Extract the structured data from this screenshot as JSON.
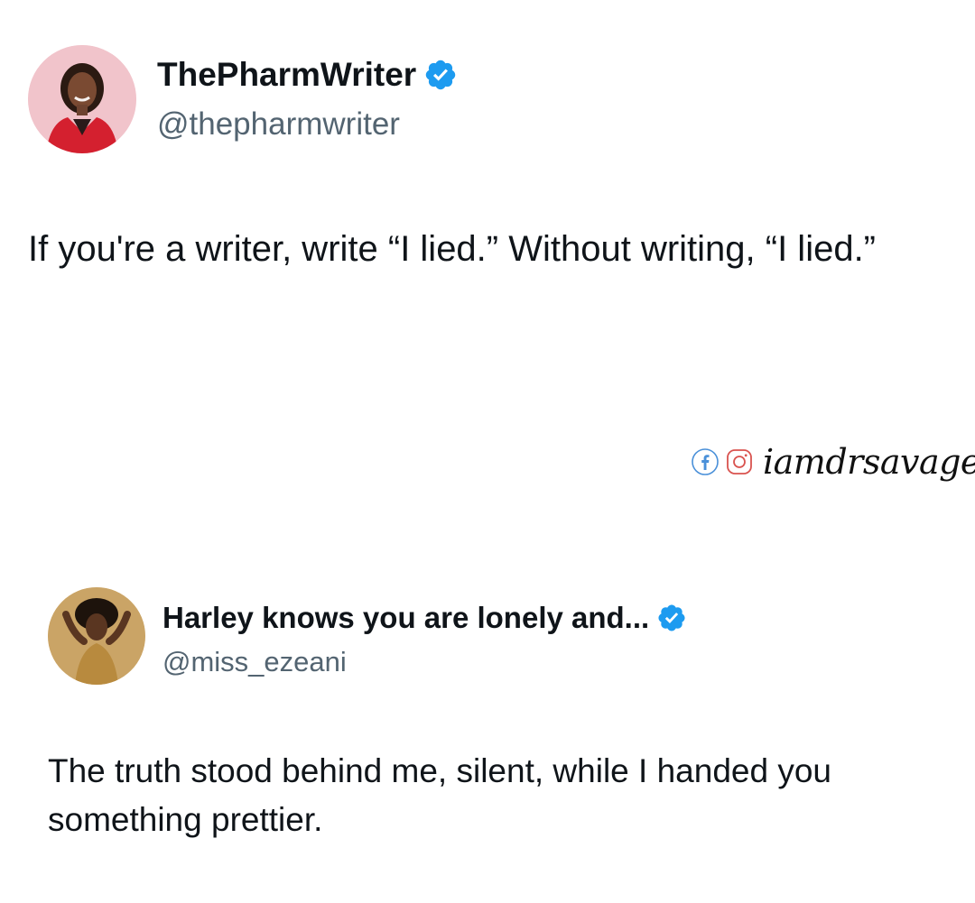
{
  "tweets": [
    {
      "display_name": "ThePharmWriter",
      "handle": "@thepharmwriter",
      "verified": true,
      "text": "If you're a writer, write “I lied.” Without writing, “I lied.”",
      "avatar_icon": "profile-photo-woman-red-blazer"
    },
    {
      "display_name": "Harley knows you are lonely and...",
      "handle": "@miss_ezeani",
      "verified": true,
      "text": "The truth stood behind me, silent, while I handed you something prettier.",
      "avatar_icon": "profile-photo-woman-golden"
    }
  ],
  "watermark": {
    "text": "iamdrsavage",
    "icons": [
      "facebook-icon",
      "instagram-icon"
    ]
  },
  "colors": {
    "verified_badge": "#1d9bf0",
    "handle": "#536471",
    "text": "#0f1419",
    "background": "#ffffff"
  }
}
